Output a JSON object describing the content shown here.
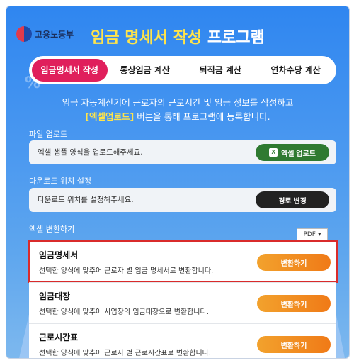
{
  "header": {
    "logo_text": "고용노동부",
    "title_highlight": "임금 명세서 작성",
    "title_rest": "프로그램"
  },
  "tabs": [
    {
      "label": "임금명세서 작성",
      "active": true
    },
    {
      "label": "통상임금 계산",
      "active": false
    },
    {
      "label": "퇴직금 계산",
      "active": false
    },
    {
      "label": "연차수당 계산",
      "active": false
    }
  ],
  "intro": {
    "line1": "임금 자동계산기에 근로자의 근로시간 및 임금 정보를 작성하고",
    "highlight": "[엑셀업로드]",
    "line2_rest": " 버튼을 통해 프로그램에 등록합니다."
  },
  "upload": {
    "label": "파일 업로드",
    "placeholder": "엑셀 샘플 양식을 업로드해주세요.",
    "button": "엑셀 업로드",
    "icon": "excel-icon"
  },
  "download": {
    "label": "다운로드 위치 설정",
    "placeholder": "다운로드 위치를 설정해주세요.",
    "button": "경로 변경"
  },
  "convert": {
    "label": "엑셀 변환하기",
    "format_selected": "PDF",
    "items": [
      {
        "title": "임금명세서",
        "desc": "선택한 양식에 맞추어 근로자 별 임금 명세서로 변환합니다.",
        "button": "변환하기",
        "selected": true
      },
      {
        "title": "임금대장",
        "desc": "선택한 양식에 맞추어 사업장의 임금대장으로 변환합니다.",
        "button": "변환하기",
        "selected": false
      },
      {
        "title": "근로시간표",
        "desc": "선택한 양식에 맞추어 근로자 별 근로시간표로 변환합니다.",
        "button": "변환하기",
        "selected": false
      }
    ]
  },
  "colors": {
    "accent_tab": "#e01f5c",
    "highlight_text": "#ffe44a",
    "upload_button": "#2f7a31",
    "path_button": "#222222",
    "convert_button": "#f07a17",
    "selection_outline": "#d92b2b"
  }
}
